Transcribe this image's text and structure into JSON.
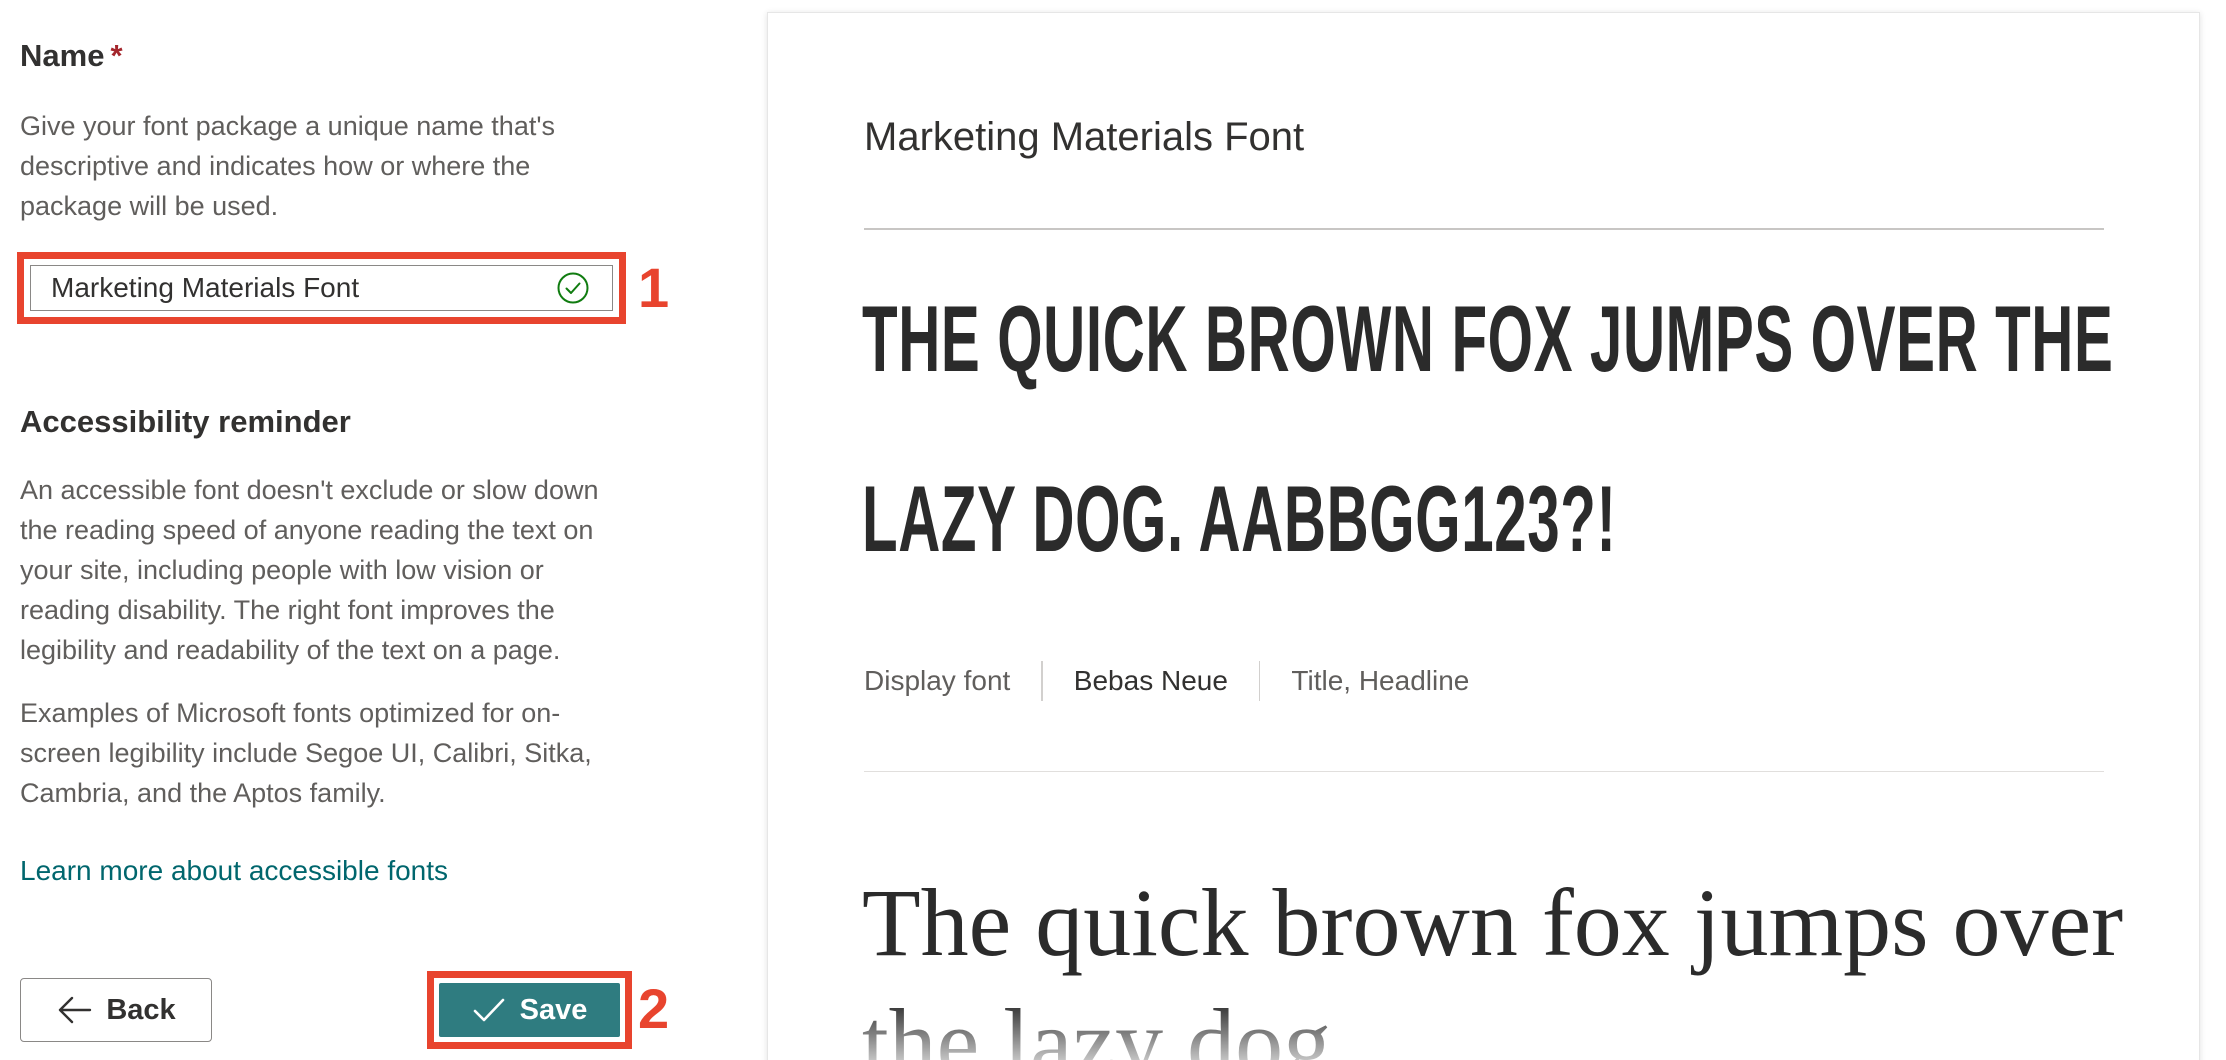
{
  "form": {
    "name_label": "Name",
    "required_marker": "*",
    "name_help": "Give your font package a unique name that's descriptive and indicates how or where the package will be used.",
    "name_value": "Marketing Materials Font",
    "accessibility_title": "Accessibility reminder",
    "accessibility_text_1": "An accessible font doesn't exclude or slow down the reading speed of anyone reading the text on your site, including people with low vision or reading disability. The right font improves the legibility and readability of the text on a page.",
    "accessibility_text_2": "Examples of Microsoft fonts optimized for on-screen legibility include Segoe UI, Calibri, Sitka, Cambria, and the Aptos family.",
    "learn_more_link": "Learn more about accessible fonts",
    "back_label": "Back",
    "save_label": "Save"
  },
  "callouts": {
    "one": "1",
    "two": "2"
  },
  "preview": {
    "title": "Marketing Materials Font",
    "display_sample": "THE QUICK BROWN FOX JUMPS OVER THE LAZY DOG. AABBGG123?!",
    "display_role": "Display font",
    "display_font_name": "Bebas Neue",
    "display_usage": "Title, Headline",
    "body_sample": "The quick brown fox jumps over the lazy dog"
  },
  "icons": {
    "valid": "checkmark-circle-icon",
    "back": "arrow-left-icon",
    "save": "checkmark-icon"
  },
  "colors": {
    "accent": "#2f7c80",
    "link": "#00666d",
    "annotation": "#e8442e",
    "required": "#a4262c",
    "valid": "#107c10"
  }
}
